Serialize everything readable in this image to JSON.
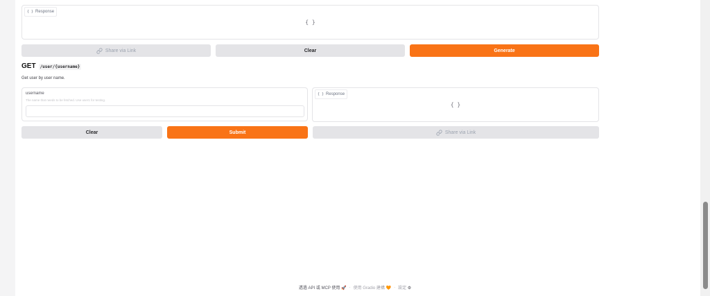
{
  "top_response": {
    "label": "Response",
    "label_icon": "{ }",
    "value": "{ }"
  },
  "top_actions": {
    "share_label": "Share via Link",
    "clear_label": "Clear",
    "generate_label": "Generate"
  },
  "endpoint": {
    "method": "GET",
    "path": "/user/{username}",
    "description": "Get user by user name."
  },
  "username_field": {
    "label": "username",
    "info": "The name that needs to be fetched. Use user1 for testing.",
    "value": ""
  },
  "bottom_response": {
    "label": "Response",
    "label_icon": "{ }",
    "value": "{ }"
  },
  "bottom_actions": {
    "clear_label": "Clear",
    "submit_label": "Submit",
    "share_label": "Share via Link"
  },
  "footer": {
    "api_label": "透過 API 或 MCP 使用",
    "api_icon": "🚀",
    "built_with": "使用 Gradio 建構",
    "built_icon": "🧡",
    "settings_label": "設定",
    "settings_icon": "⚙",
    "separator": "·"
  },
  "colors": {
    "accent": "#f97316",
    "secondary": "#e4e4e7"
  }
}
